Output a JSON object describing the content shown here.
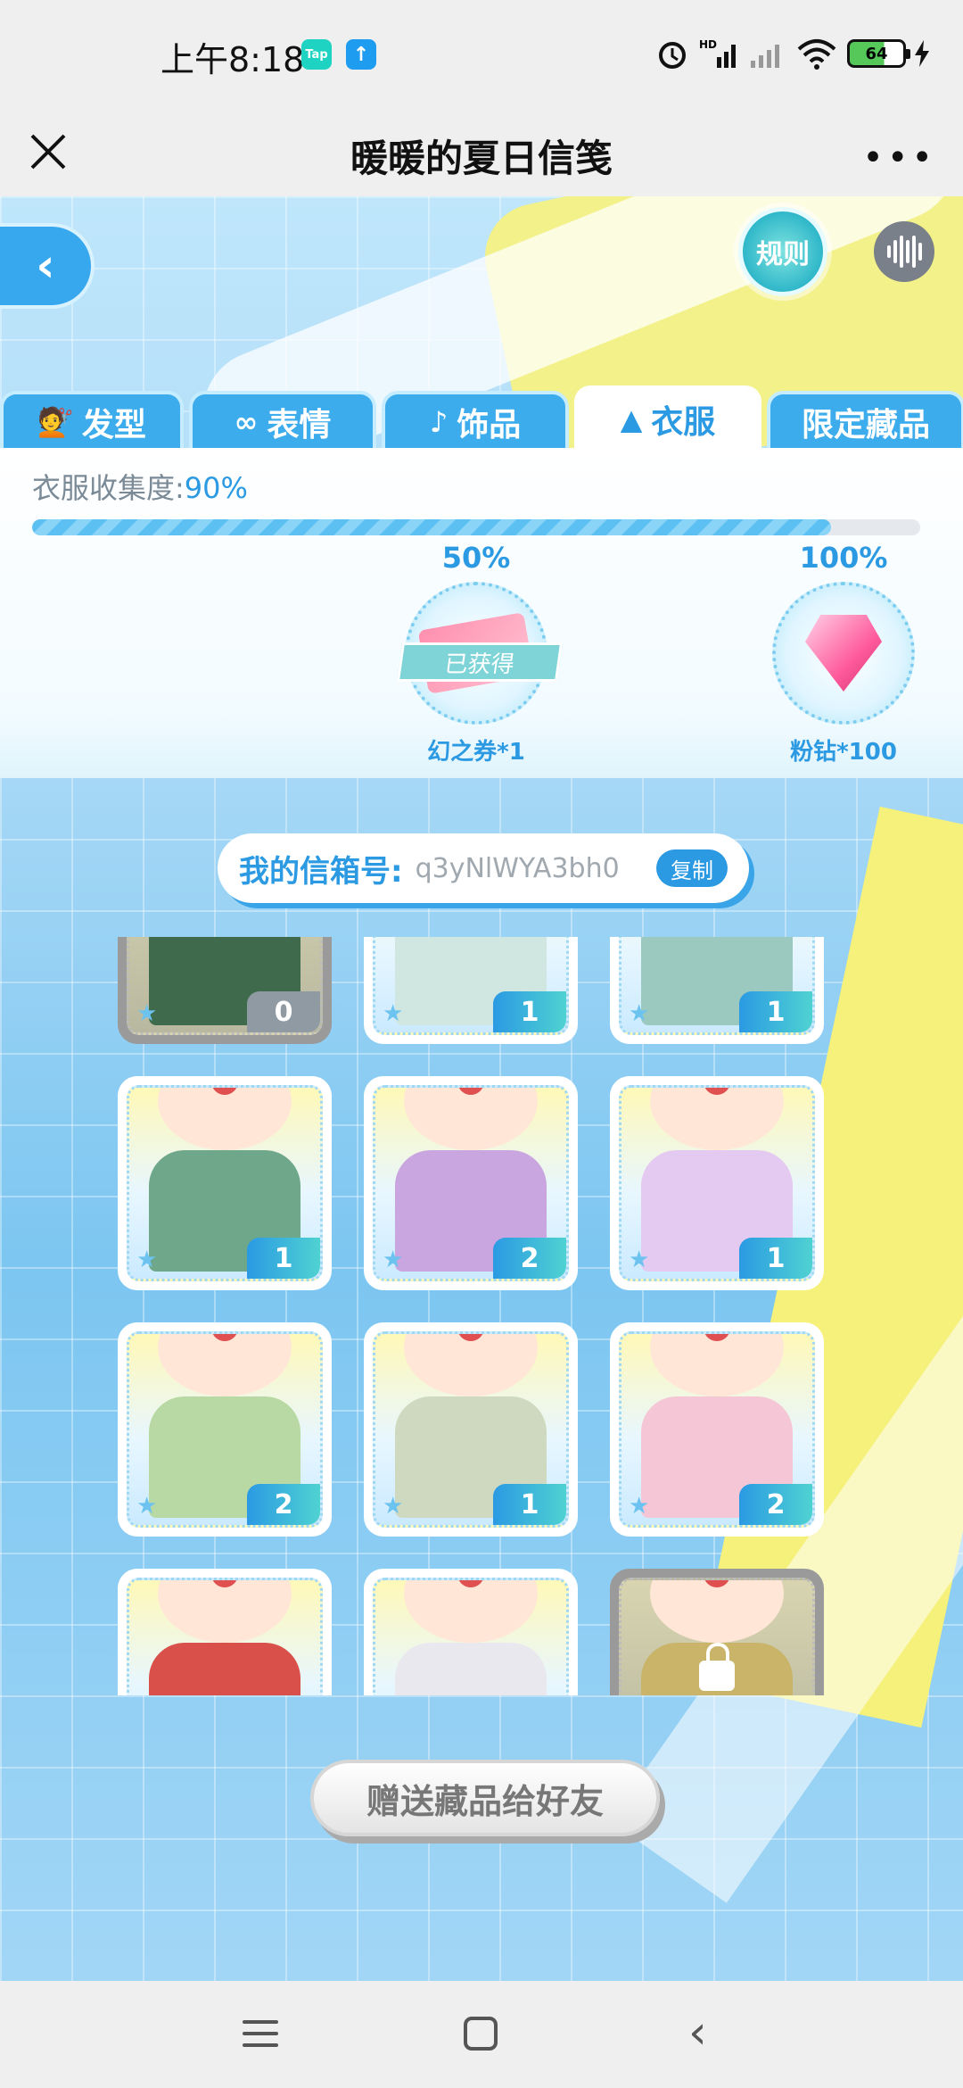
{
  "status_bar": {
    "time": "上午8:18",
    "app_badges": [
      "Tap",
      "↑"
    ],
    "network": "HD",
    "battery": "64"
  },
  "title_bar": {
    "title": "暖暖的夏日信笺",
    "more": "•••"
  },
  "game": {
    "back_symbol": "‹",
    "rules_label": "规则",
    "tabs": [
      {
        "label": "发型",
        "icon": "hair-icon",
        "glyph": "💇"
      },
      {
        "label": "表情",
        "icon": "mask-icon",
        "glyph": "∞"
      },
      {
        "label": "饰品",
        "icon": "earring-icon",
        "glyph": "♪"
      },
      {
        "label": "衣服",
        "icon": "hat-icon",
        "glyph": "▲",
        "active": true
      },
      {
        "label": "限定藏品",
        "icon": "",
        "glyph": ""
      }
    ],
    "collection": {
      "label": "衣服收集度:",
      "percent_text": "90%",
      "progress": 0.9
    },
    "rewards": [
      {
        "threshold": "50%",
        "name": "幻之券*1",
        "status": "已获得"
      },
      {
        "threshold": "100%",
        "name": "粉钻*100",
        "status": ""
      }
    ],
    "mailbox": {
      "label": "我的信箱号:",
      "code": "q3yNlWYA3bh0",
      "copy_label": "复制"
    },
    "items": [
      {
        "count": "0",
        "locked": false,
        "gray": true,
        "color": "#3f6a4c"
      },
      {
        "count": "1",
        "locked": false,
        "gray": false,
        "color": "#cfe7e0"
      },
      {
        "count": "1",
        "locked": false,
        "gray": false,
        "color": "#9cc9bf"
      },
      {
        "count": "1",
        "locked": false,
        "gray": false,
        "color": "#6fa78a"
      },
      {
        "count": "2",
        "locked": false,
        "gray": false,
        "color": "#c9a6e0"
      },
      {
        "count": "1",
        "locked": false,
        "gray": false,
        "color": "#e4c9f0"
      },
      {
        "count": "2",
        "locked": false,
        "gray": false,
        "color": "#b8d9a3"
      },
      {
        "count": "1",
        "locked": false,
        "gray": false,
        "color": "#cfd9c0"
      },
      {
        "count": "2",
        "locked": false,
        "gray": false,
        "color": "#f5c6d6"
      },
      {
        "count": "",
        "locked": false,
        "gray": false,
        "color": "#d9504b"
      },
      {
        "count": "",
        "locked": false,
        "gray": false,
        "color": "#e8e8ee"
      },
      {
        "count": "",
        "locked": true,
        "gray": true,
        "color": "#c9b46a"
      }
    ],
    "gift_button": "赠送藏品给好友"
  },
  "nav_bar": {
    "items": [
      "menu-icon",
      "home-icon",
      "back-icon"
    ]
  }
}
